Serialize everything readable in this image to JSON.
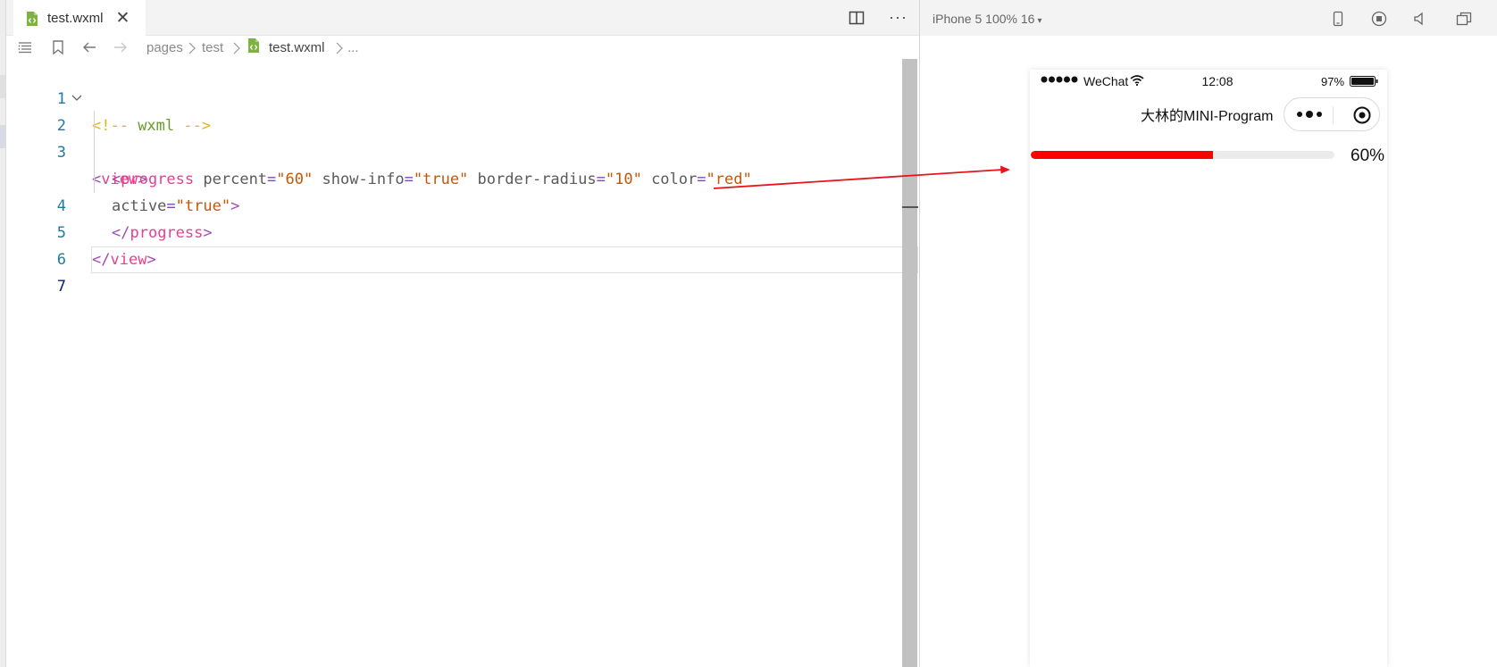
{
  "editor": {
    "tab": {
      "title": "test.wxml",
      "close_glyph": "✕",
      "icon": "wxml-file-icon"
    },
    "more_glyph": "···",
    "breadcrumbs": [
      "pages",
      "test",
      "test.wxml",
      "..."
    ],
    "code_lines": [
      {
        "number": "1"
      },
      {
        "number": "2"
      },
      {
        "number": "3"
      },
      {
        "number": ""
      },
      {
        "number": "4"
      },
      {
        "number": "5"
      },
      {
        "number": "6"
      },
      {
        "number": "7"
      }
    ],
    "tokens": {
      "comment_open": "<!--",
      "comment_body": " wxml ",
      "comment_close": "-->",
      "lt": "<",
      "gt": ">",
      "lt_slash": "</",
      "view_tag": "view",
      "progress_tag": "progress",
      "attr_percent": "percent",
      "val_percent": "\"60\"",
      "attr_show_info": "show-info",
      "val_show_info": "\"true\"",
      "attr_border_radius": "border-radius",
      "val_border_radius": "\"10\"",
      "attr_color": "color",
      "val_color": "\"red\"",
      "attr_active": "active",
      "val_active": "\"true\"",
      "eq": "="
    }
  },
  "simulator": {
    "device": "iPhone 5 100% 16",
    "caret": "▾",
    "statusbar": {
      "carrier": "WeChat",
      "time": "12:08",
      "battery": "97%"
    },
    "navbar": {
      "title": "大林的MINI-Program"
    },
    "progress": {
      "percent": 0.6,
      "info": "60%",
      "color": "#ff0000",
      "background": "#ebebeb"
    }
  },
  "colors": {
    "annotation_arrow": "#e8141b"
  }
}
